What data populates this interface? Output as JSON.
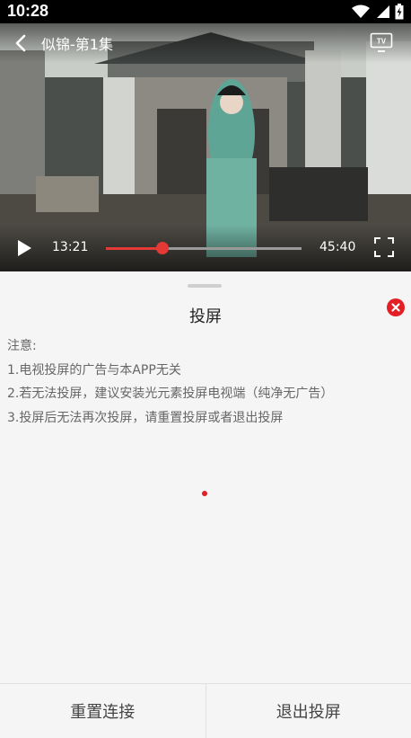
{
  "status_bar": {
    "time": "10:28"
  },
  "player": {
    "title": "似锦-第1集",
    "current_time": "13:21",
    "duration": "45:40",
    "progress_fraction": 0.29
  },
  "sheet": {
    "title": "投屏",
    "notes": [
      "注意:",
      "1.电视投屏的广告与本APP无关",
      "2.若无法投屏，建议安装光元素投屏电视端（纯净无广告）",
      "3.投屏后无法再次投屏，请重置投屏或者退出投屏"
    ]
  },
  "footer": {
    "reset_label": "重置连接",
    "exit_label": "退出投屏"
  },
  "colors": {
    "accent": "#e31e25"
  }
}
